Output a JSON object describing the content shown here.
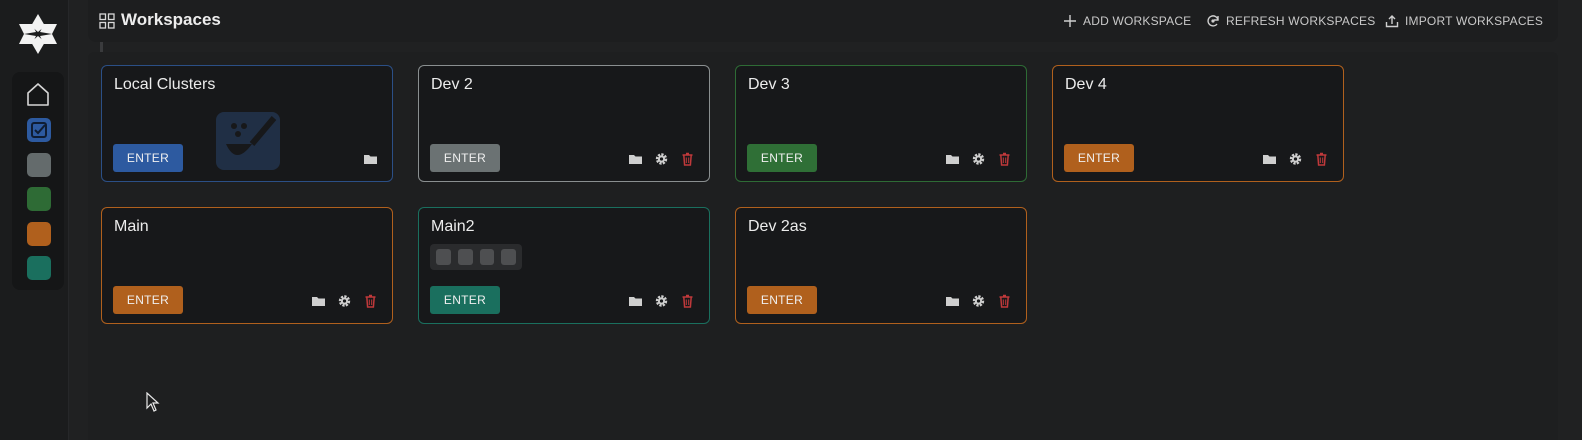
{
  "header": {
    "title": "Workspaces",
    "actions": [
      {
        "label": "ADD WORKSPACE",
        "icon": "plus-icon"
      },
      {
        "label": "REFRESH WORKSPACES",
        "icon": "refresh-icon"
      },
      {
        "label": "IMPORT WORKSPACES",
        "icon": "upload-icon"
      }
    ]
  },
  "sidebar": {
    "items": [
      {
        "name": "home",
        "icon": "home-icon"
      },
      {
        "name": "local-clusters",
        "color": "#2d5aa0"
      },
      {
        "name": "dev-2",
        "color": "#646b6c"
      },
      {
        "name": "dev-3",
        "color": "#2e6b35"
      },
      {
        "name": "orange",
        "color": "#b0601d"
      },
      {
        "name": "main2",
        "color": "#1a6f5e"
      }
    ]
  },
  "workspaces": [
    {
      "name": "Local Clusters",
      "enter_label": "ENTER",
      "color": "#2d5aa0",
      "border": "#2b4f86",
      "icons": [
        "folder-icon"
      ]
    },
    {
      "name": "Dev 2",
      "enter_label": "ENTER",
      "color": "#6b7273",
      "border": "#8a8f90",
      "icons": [
        "folder-icon",
        "gear-icon",
        "trash-icon"
      ]
    },
    {
      "name": "Dev 3",
      "enter_label": "ENTER",
      "color": "#2f6f36",
      "border": "#2e6b35",
      "icons": [
        "folder-icon",
        "gear-icon",
        "trash-icon"
      ]
    },
    {
      "name": "Dev 4",
      "enter_label": "ENTER",
      "color": "#b0601d",
      "border": "#b0601d",
      "icons": [
        "folder-icon",
        "gear-icon",
        "trash-icon"
      ]
    },
    {
      "name": "Main",
      "enter_label": "ENTER",
      "color": "#b0601d",
      "border": "#b0601d",
      "icons": [
        "folder-icon",
        "gear-icon",
        "trash-icon"
      ]
    },
    {
      "name": "Main2",
      "enter_label": "ENTER",
      "color": "#1a6f5e",
      "border": "#1a6f5e",
      "icons": [
        "folder-icon",
        "gear-icon",
        "trash-icon"
      ]
    },
    {
      "name": "Dev 2as",
      "enter_label": "ENTER",
      "color": "#b0601d",
      "border": "#b0601d",
      "icons": [
        "folder-icon",
        "gear-icon",
        "trash-icon"
      ]
    }
  ],
  "colors": {
    "background": "#202122",
    "card": "#17181a",
    "trash": "#c0393b"
  }
}
